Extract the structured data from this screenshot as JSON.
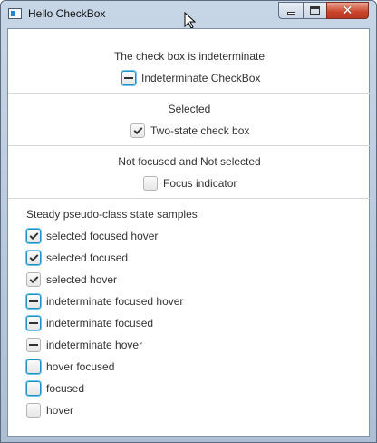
{
  "window": {
    "title": "Hello CheckBox",
    "controls": {
      "minimize": "minimize",
      "maximize": "maximize",
      "close": "✕"
    }
  },
  "sections": {
    "indeterminate": {
      "label": "The check box is indeterminate",
      "checkbox_label": "Indeterminate CheckBox",
      "state": "indeterminate"
    },
    "selected": {
      "label": "Selected",
      "checkbox_label": "Two-state check box",
      "state": "selected"
    },
    "not_focused": {
      "label": "Not focused and Not selected",
      "checkbox_label": "Focus indicator",
      "state": "unselected"
    }
  },
  "samples": {
    "heading": "Steady pseudo-class state samples",
    "items": [
      {
        "label": "selected focused hover",
        "state": "selected",
        "focused": true
      },
      {
        "label": "selected focused",
        "state": "selected",
        "focused": true
      },
      {
        "label": "selected hover",
        "state": "selected",
        "focused": false
      },
      {
        "label": "indeterminate focused hover",
        "state": "indeterminate",
        "focused": true
      },
      {
        "label": "indeterminate focused",
        "state": "indeterminate",
        "focused": true
      },
      {
        "label": "indeterminate hover",
        "state": "indeterminate",
        "focused": false
      },
      {
        "label": "hover focused",
        "state": "unselected",
        "focused": true
      },
      {
        "label": "focused",
        "state": "unselected",
        "focused": true
      },
      {
        "label": "hover",
        "state": "unselected",
        "focused": false
      }
    ]
  },
  "colors": {
    "focus_ring": "#1e90c8",
    "titlebar": "#c7d6e6",
    "close_button": "#c8452a"
  }
}
